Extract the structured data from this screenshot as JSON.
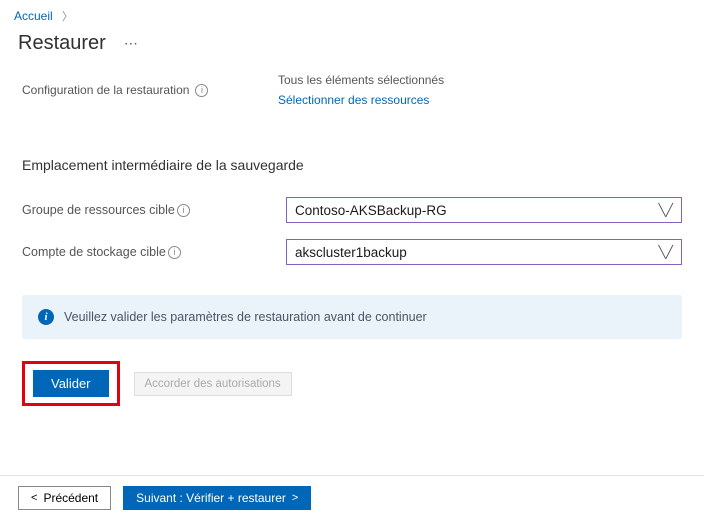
{
  "breadcrumb": {
    "home": "Accueil"
  },
  "header": {
    "title": "Restaurer"
  },
  "config": {
    "label": "Configuration de la restauration",
    "status": "Tous les éléments sélectionnés",
    "link": "Sélectionner des ressources"
  },
  "staging": {
    "heading": "Emplacement intermédiaire de la sauvegarde",
    "rg_label": "Groupe de ressources cible",
    "rg_value": "Contoso-AKSBackup-RG",
    "sa_label": "Compte de stockage cible",
    "sa_value": "akscluster1backup"
  },
  "banner": {
    "text": "Veuillez valider les paramètres de restauration avant de continuer"
  },
  "actions": {
    "validate": "Valider",
    "grant": "Accorder des autorisations"
  },
  "footer": {
    "prev": "Précédent",
    "next": "Suivant : Vérifier +  restaurer"
  }
}
